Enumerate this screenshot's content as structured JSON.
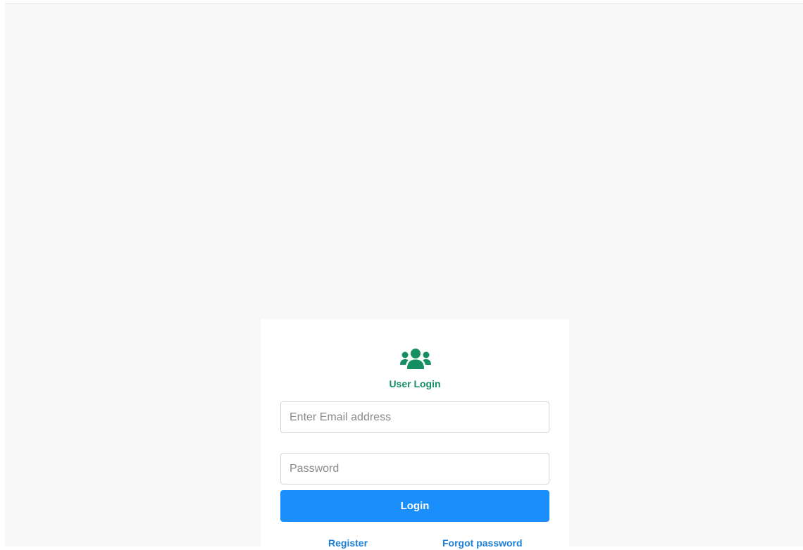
{
  "login": {
    "icon": "users-icon",
    "title": "User Login",
    "email_placeholder": "Enter Email address",
    "password_placeholder": "Password",
    "login_label": "Login",
    "register_label": "Register",
    "forgot_label": "Forgot password"
  },
  "colors": {
    "page_background": "#f8f8f8",
    "card_background": "#ffffff",
    "accent_green": "#158f61",
    "button_blue": "#1a8efa",
    "link_blue": "#1b7fd6"
  }
}
